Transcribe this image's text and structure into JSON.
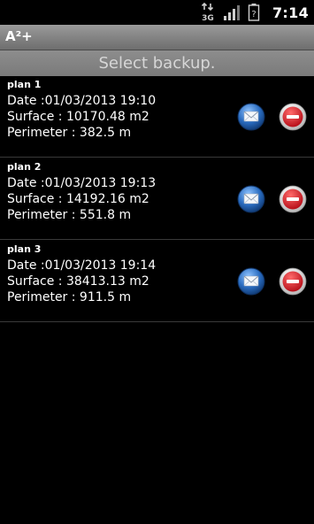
{
  "status_bar": {
    "time": "7:14",
    "network_label": "3G",
    "icons": [
      "data-arrows-3g-icon",
      "signal-icon",
      "battery-icon"
    ]
  },
  "app": {
    "title": "A²+"
  },
  "header": {
    "title": "Select backup."
  },
  "colors": {
    "background": "#000000",
    "header_text": "#d6d6d6",
    "mail_blue": "#2a6cc0",
    "delete_red": "#c8202a"
  },
  "plans": [
    {
      "name": "plan 1",
      "date": "Date :01/03/2013 19:10",
      "surface": "Surface : 10170.48 m2",
      "perimeter": "Perimeter : 382.5 m",
      "actions": [
        "mail-icon",
        "delete-icon"
      ]
    },
    {
      "name": "plan 2",
      "date": "Date :01/03/2013 19:13",
      "surface": "Surface : 14192.16 m2",
      "perimeter": "Perimeter : 551.8 m",
      "actions": [
        "mail-icon",
        "delete-icon"
      ]
    },
    {
      "name": "plan 3",
      "date": "Date :01/03/2013 19:14",
      "surface": "Surface : 38413.13 m2",
      "perimeter": "Perimeter : 911.5 m",
      "actions": [
        "mail-icon",
        "delete-icon"
      ]
    }
  ]
}
